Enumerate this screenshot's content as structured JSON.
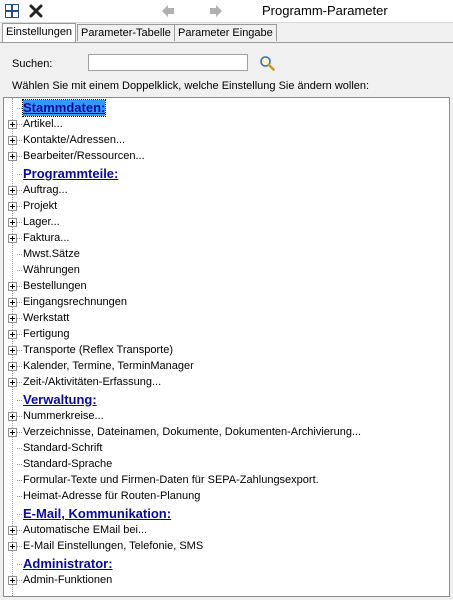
{
  "window": {
    "title": "Programm-Parameter"
  },
  "tabs": [
    {
      "label": "Einstellungen"
    },
    {
      "label": "Parameter-Tabelle"
    },
    {
      "label": "Parameter Eingabe"
    }
  ],
  "search": {
    "label": "Suchen:",
    "value": "",
    "placeholder": ""
  },
  "hint": "Wählen Sie mit einem Doppelklick, welche Einstellung Sie ändern wollen:",
  "tree": [
    {
      "label": "Stammdaten:",
      "header": true,
      "selected": true
    },
    {
      "label": "Artikel...",
      "expandable": true
    },
    {
      "label": "Kontakte/Adressen...",
      "expandable": true
    },
    {
      "label": "Bearbeiter/Ressourcen...",
      "expandable": true
    },
    {
      "label": "Programmteile:",
      "header": true
    },
    {
      "label": "Auftrag...",
      "expandable": true
    },
    {
      "label": "Projekt",
      "expandable": true
    },
    {
      "label": "Lager...",
      "expandable": true
    },
    {
      "label": "Faktura...",
      "expandable": true
    },
    {
      "label": "Mwst.Sätze",
      "expandable": false
    },
    {
      "label": "Währungen",
      "expandable": false
    },
    {
      "label": "Bestellungen",
      "expandable": true
    },
    {
      "label": "Eingangsrechnungen",
      "expandable": true
    },
    {
      "label": "Werkstatt",
      "expandable": true
    },
    {
      "label": "Fertigung",
      "expandable": true
    },
    {
      "label": "Transporte (Reflex Transporte)",
      "expandable": true
    },
    {
      "label": "Kalender, Termine, TerminManager",
      "expandable": true
    },
    {
      "label": "Zeit-/Aktivitäten-Erfassung...",
      "expandable": true
    },
    {
      "label": "Verwaltung:",
      "header": true
    },
    {
      "label": "Nummerkreise...",
      "expandable": true
    },
    {
      "label": "Verzeichnisse, Dateinamen, Dokumente, Dokumenten-Archivierung...",
      "expandable": true
    },
    {
      "label": "Standard-Schrift",
      "expandable": false
    },
    {
      "label": "Standard-Sprache",
      "expandable": false
    },
    {
      "label": "Formular-Texte und Firmen-Daten für SEPA-Zahlungsexport.",
      "expandable": false
    },
    {
      "label": "Heimat-Adresse für Routen-Planung",
      "expandable": false
    },
    {
      "label": "E-Mail, Kommunikation:",
      "header": true
    },
    {
      "label": "Automatische EMail bei...",
      "expandable": true
    },
    {
      "label": "E-Mail Einstellungen, Telefonie, SMS",
      "expandable": true
    },
    {
      "label": "Administrator:",
      "header": true
    },
    {
      "label": "Admin-Funktionen",
      "expandable": true
    }
  ]
}
